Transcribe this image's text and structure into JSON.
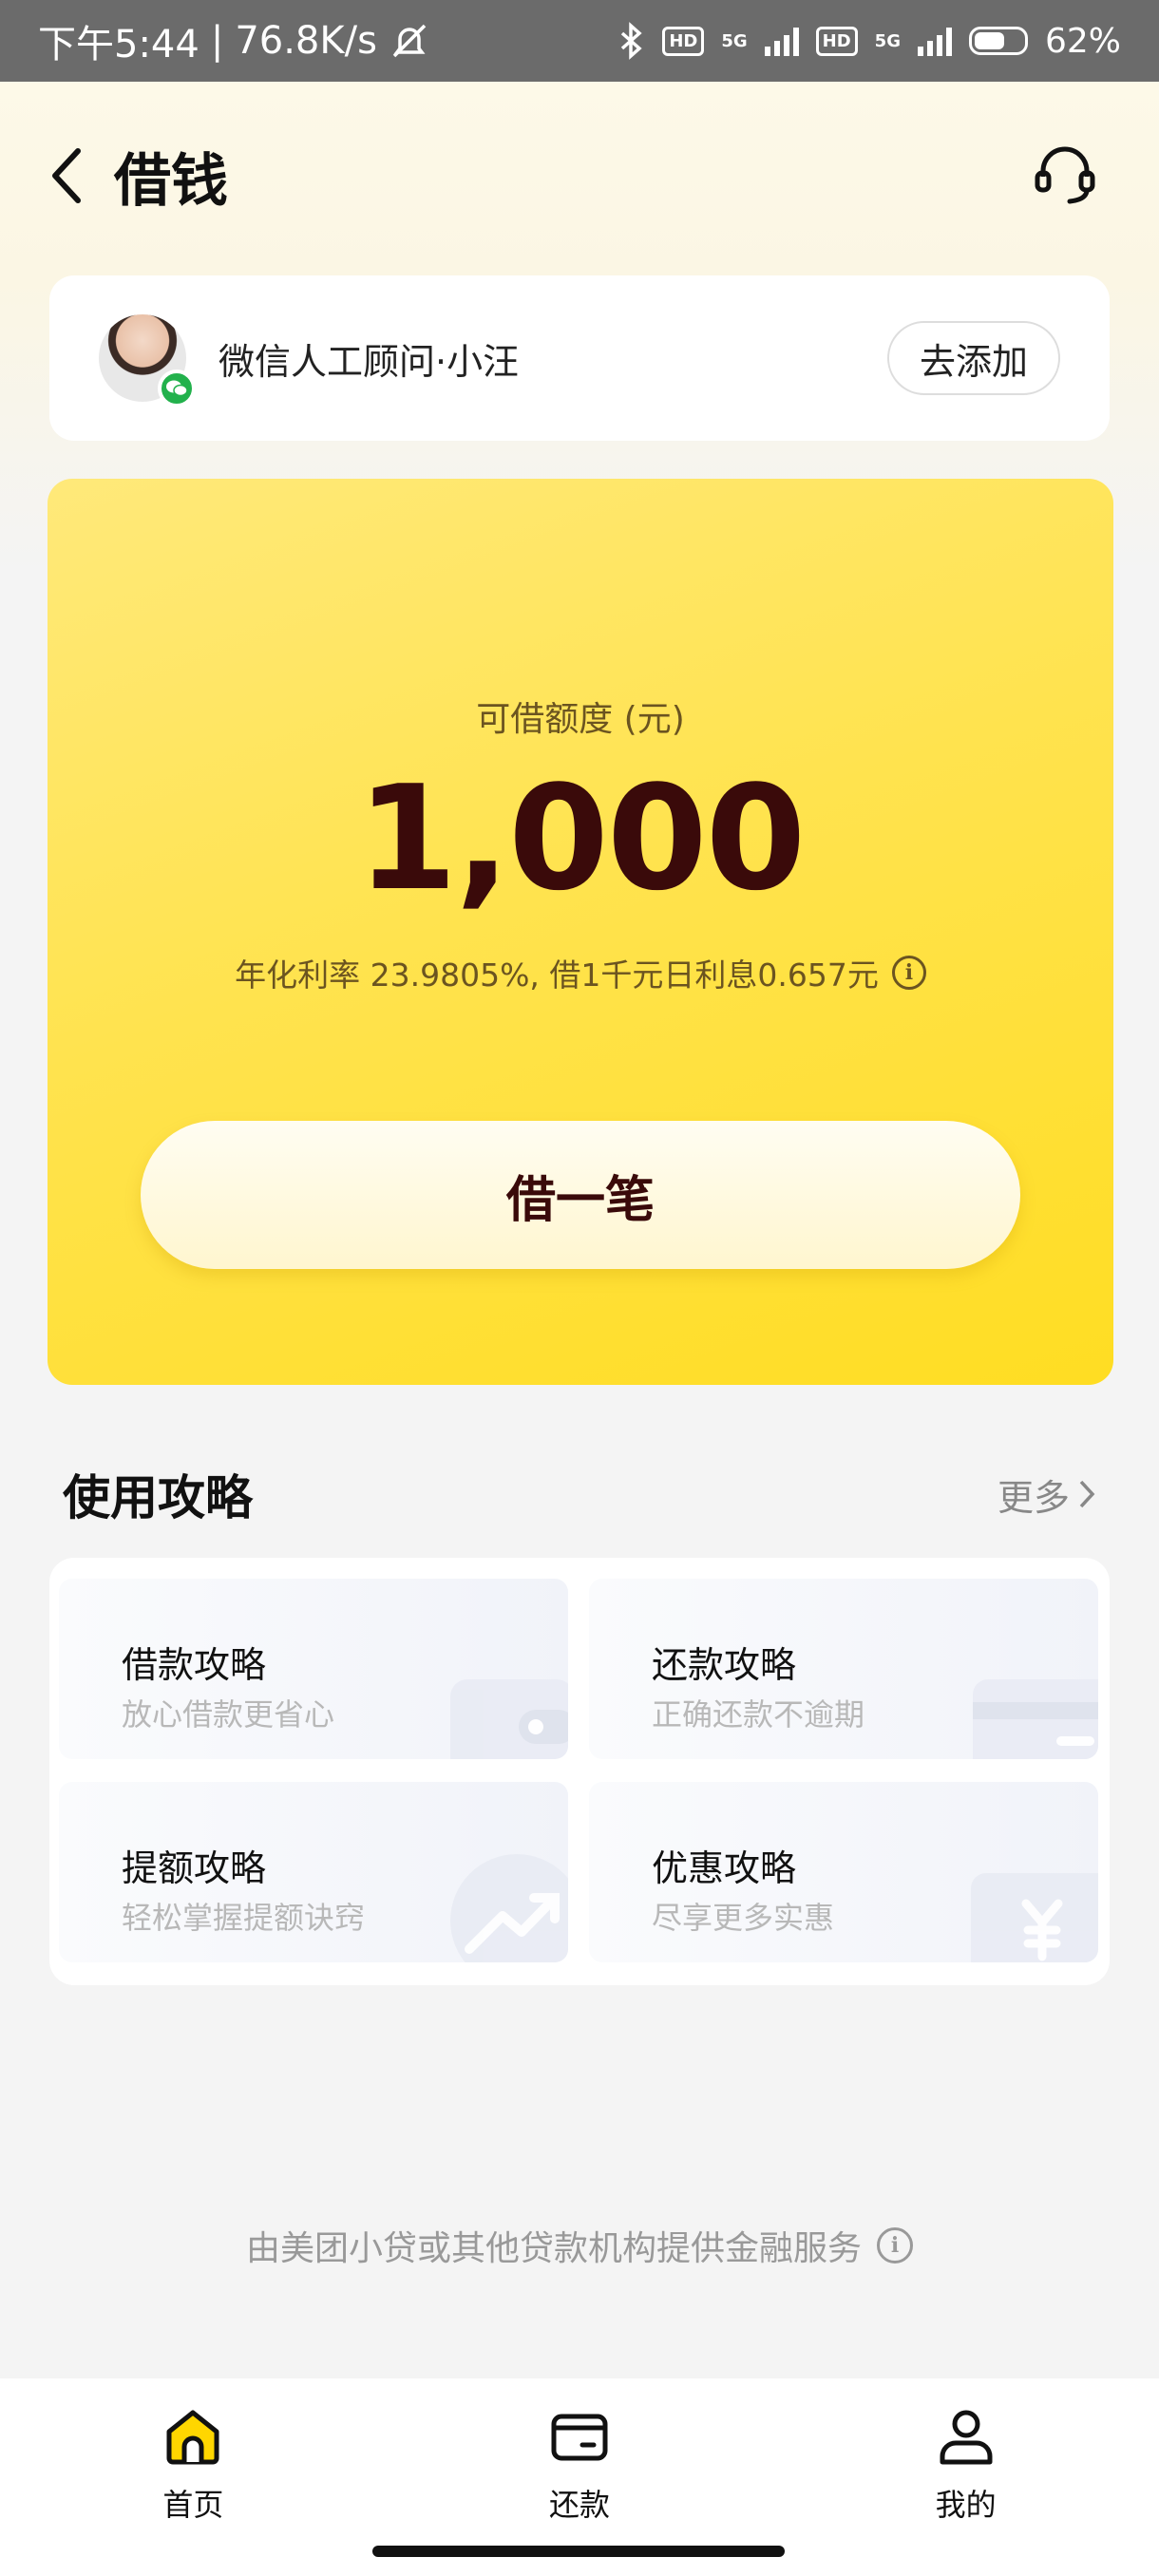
{
  "status_bar": {
    "time": "下午5:44",
    "net_speed": "76.8K/s",
    "hd_badge_1": "HD",
    "net_type_1": "5G",
    "hd_badge_2": "HD",
    "net_type_2": "5G",
    "battery": "62%",
    "battery_level": 0.62
  },
  "header": {
    "title": "借钱"
  },
  "advisor": {
    "name": "微信人工顾问·小汪",
    "add_label": "去添加"
  },
  "credit": {
    "label": "可借额度 (元)",
    "amount": "1,000",
    "rate_text": "年化利率 23.9805%, 借1千元日利息0.657元",
    "borrow_label": "借一笔"
  },
  "guide": {
    "title": "使用攻略",
    "more_label": "更多",
    "items": [
      {
        "title": "借款攻略",
        "subtitle": "放心借款更省心"
      },
      {
        "title": "还款攻略",
        "subtitle": "正确还款不逾期"
      },
      {
        "title": "提额攻略",
        "subtitle": "轻松掌握提额诀窍"
      },
      {
        "title": "优惠攻略",
        "subtitle": "尽享更多实惠"
      }
    ]
  },
  "footer_note": "由美团小贷或其他贷款机构提供金融服务",
  "nav": {
    "items": [
      {
        "label": "首页",
        "icon": "home-icon",
        "active": true
      },
      {
        "label": "还款",
        "icon": "wallet-icon",
        "active": false
      },
      {
        "label": "我的",
        "icon": "user-icon",
        "active": false
      }
    ]
  },
  "colors": {
    "accent_yellow": "#ffdd22",
    "amount_color": "#3a0a0a",
    "active_icon_fill": "#ffd600"
  }
}
